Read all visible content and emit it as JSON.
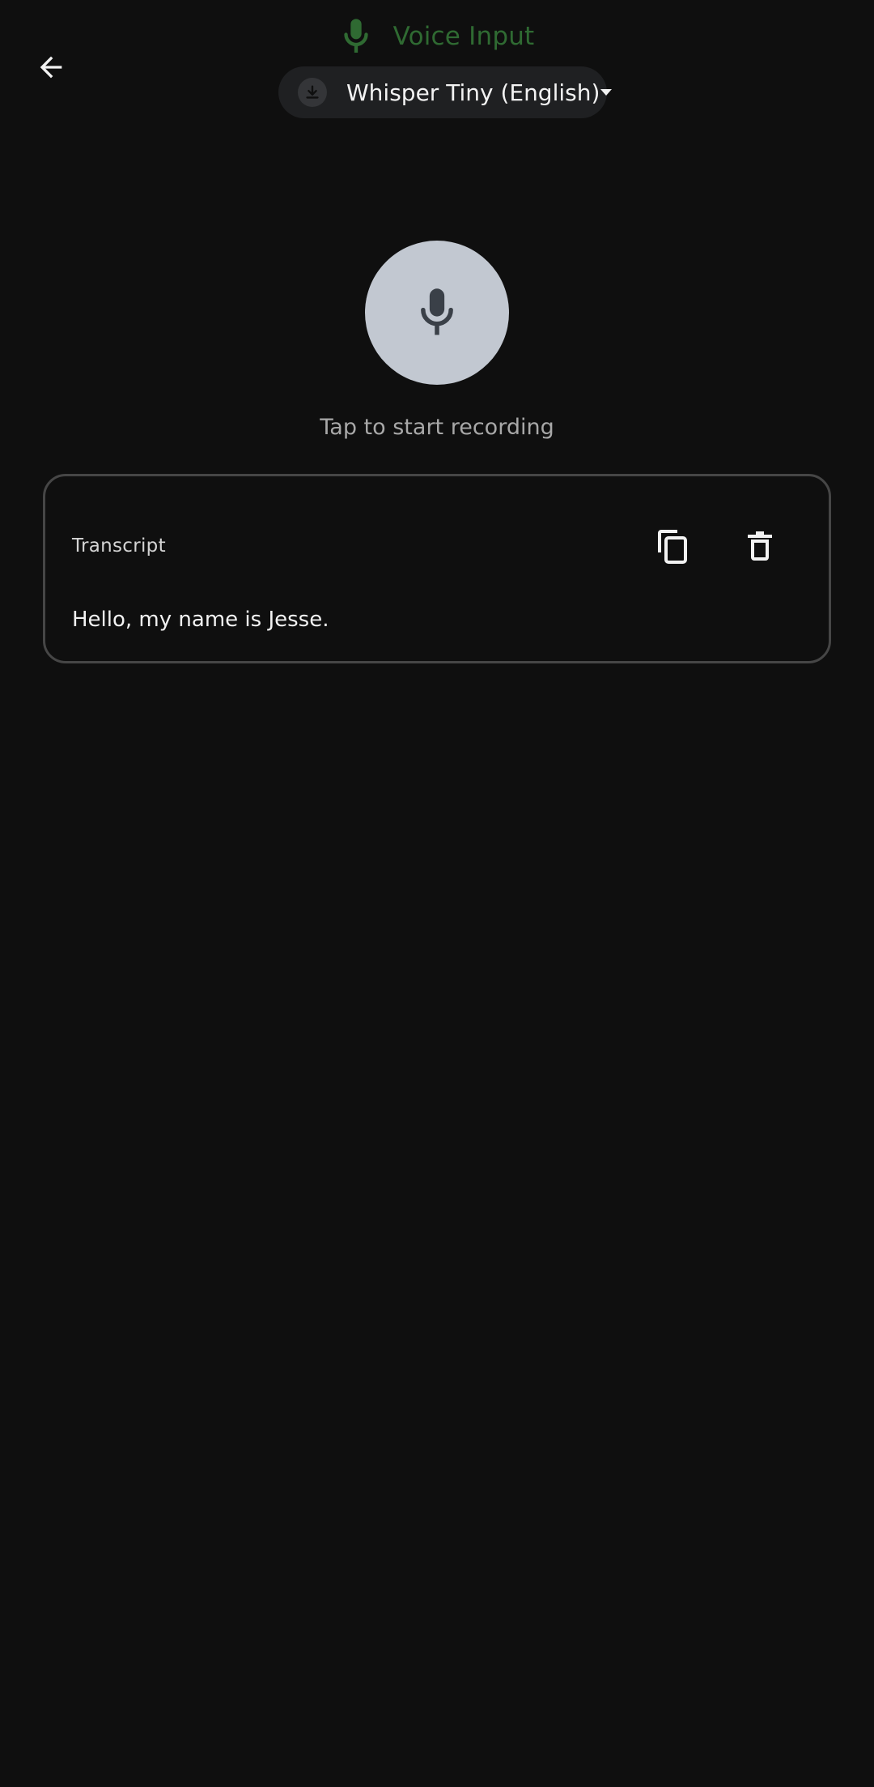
{
  "header": {
    "title": "Voice Input",
    "back_icon": "arrow-left-icon",
    "title_icon": "microphone-icon"
  },
  "model_selector": {
    "status_icon": "download-icon",
    "selected_model": "Whisper Tiny (English)",
    "dropdown_icon": "caret-down-icon"
  },
  "recorder": {
    "icon": "microphone-icon",
    "hint": "Tap to start recording"
  },
  "transcript": {
    "label": "Transcript",
    "copy_icon": "copy-icon",
    "delete_icon": "trash-icon",
    "text": "Hello, my name is Jesse."
  },
  "colors": {
    "background": "#0f0f0f",
    "title_accent": "#2f6a32",
    "record_button": "#c2c8d1",
    "pill_background": "#1f2022",
    "card_border": "#464646"
  }
}
